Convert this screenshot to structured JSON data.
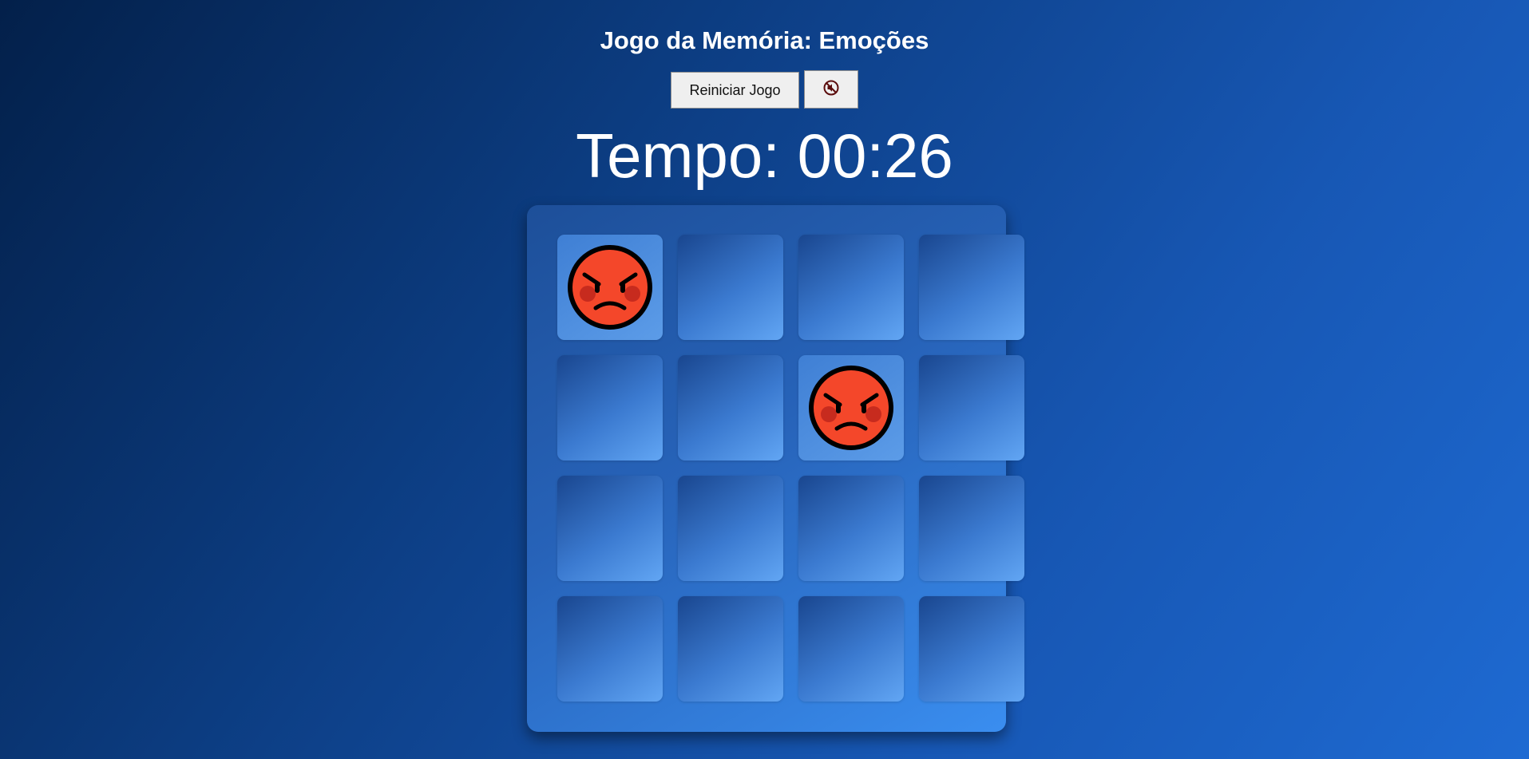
{
  "game": {
    "title": "Jogo da Memória: Emoções",
    "restart_label": "Reiniciar Jogo",
    "mute_icon": "muted-speaker-icon",
    "timer_label": "Tempo:",
    "timer_value": "00:26"
  },
  "board": {
    "rows": 4,
    "cols": 4,
    "cards": [
      {
        "state": "flipped",
        "emotion": "angry-face"
      },
      {
        "state": "hidden"
      },
      {
        "state": "hidden"
      },
      {
        "state": "hidden"
      },
      {
        "state": "hidden"
      },
      {
        "state": "hidden"
      },
      {
        "state": "flipped",
        "emotion": "angry-face"
      },
      {
        "state": "hidden"
      },
      {
        "state": "hidden"
      },
      {
        "state": "hidden"
      },
      {
        "state": "hidden"
      },
      {
        "state": "hidden"
      },
      {
        "state": "hidden"
      },
      {
        "state": "hidden"
      },
      {
        "state": "hidden"
      },
      {
        "state": "hidden"
      }
    ]
  },
  "colors": {
    "face_fill": "#f4472a",
    "face_outline": "#000000",
    "cheek": "#c72b1e",
    "mute_icon_color": "#5b0d0d"
  }
}
